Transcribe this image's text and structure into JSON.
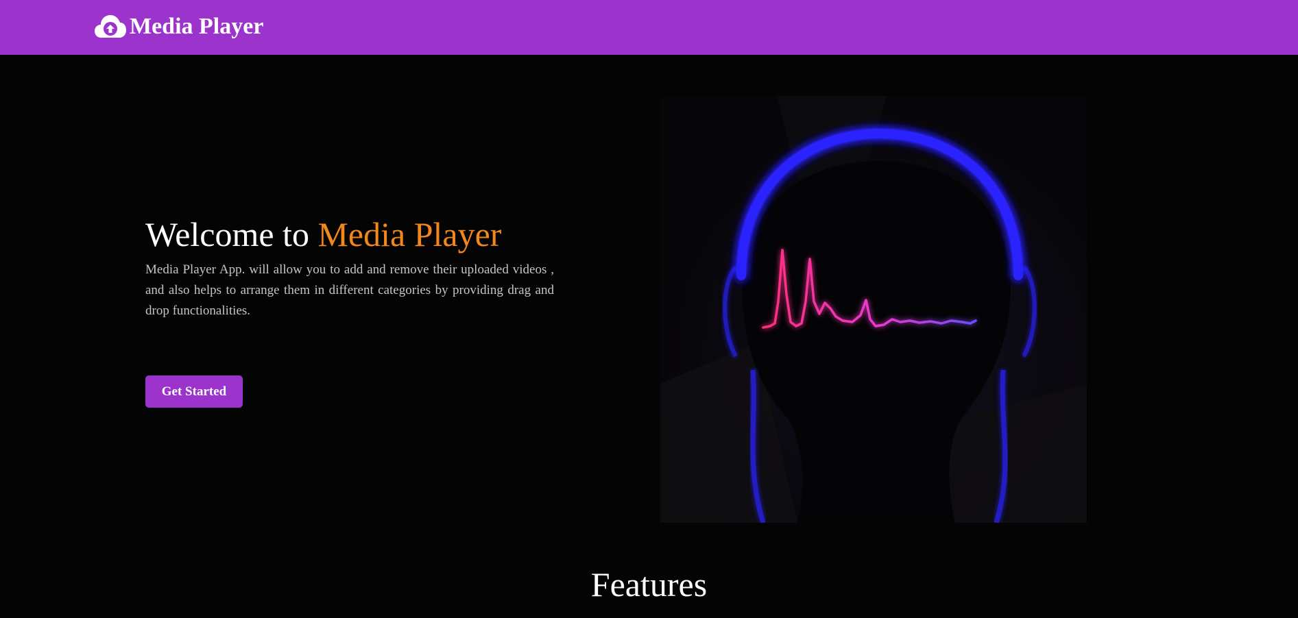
{
  "navbar": {
    "brand_icon": "cloud-upload-icon",
    "brand_text": "Media Player",
    "background_color": "#9b33cc"
  },
  "hero": {
    "title_prefix": "Welcome to ",
    "title_accent": "Media Player",
    "accent_color": "#f2871c",
    "description": "Media Player App. will allow you to add and remove their uploaded videos , and also helps to arrange them in different categories by providing drag and drop functionalities.",
    "cta_label": "Get Started",
    "image_alt": "headphones-soundwave-illustration"
  },
  "features": {
    "heading": "Features"
  }
}
